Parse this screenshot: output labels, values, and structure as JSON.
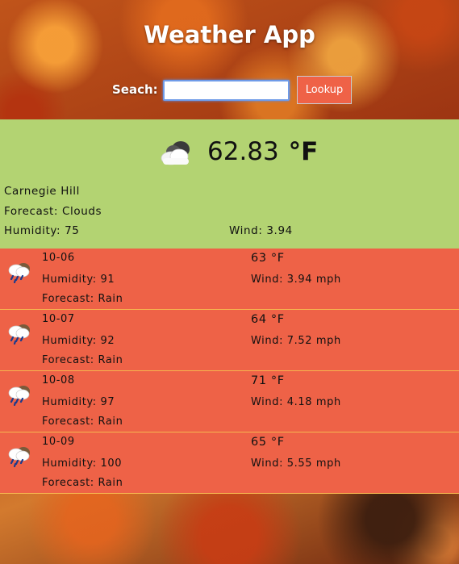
{
  "app": {
    "title": "Weather App"
  },
  "search": {
    "label": "Seach:",
    "value": "",
    "button_label": "Lookup"
  },
  "current": {
    "icon": "clouds-icon",
    "temperature": "62.83",
    "unit": "°F",
    "location": "Carnegie Hill",
    "forecast": "Forecast: Clouds",
    "humidity": "Humidity: 75",
    "wind": "Wind: 3.94"
  },
  "days": [
    {
      "icon": "rain-icon",
      "date": "10-06",
      "humidity": "Humidity: 91",
      "forecast": "Forecast: Rain",
      "temp": "63 °F",
      "wind": "Wind: 3.94 mph"
    },
    {
      "icon": "rain-icon",
      "date": "10-07",
      "humidity": "Humidity: 92",
      "forecast": "Forecast: Rain",
      "temp": "64 °F",
      "wind": "Wind: 7.52 mph"
    },
    {
      "icon": "rain-icon",
      "date": "10-08",
      "humidity": "Humidity: 97",
      "forecast": "Forecast: Rain",
      "temp": "71 °F",
      "wind": "Wind: 4.18 mph"
    },
    {
      "icon": "rain-icon",
      "date": "10-09",
      "humidity": "Humidity: 100",
      "forecast": "Forecast: Rain",
      "temp": "65 °F",
      "wind": "Wind: 5.55 mph"
    }
  ],
  "colors": {
    "current_bg": "#b3d372",
    "forecast_bg": "#ee6247",
    "divider": "#f6b64f",
    "button_bg": "#ef6247"
  }
}
